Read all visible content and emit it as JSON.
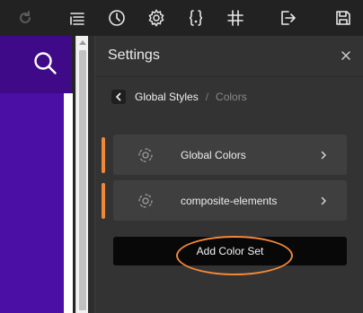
{
  "toolbar": {
    "icons": [
      "redo-icon",
      "history-list-icon",
      "clock-icon",
      "gear-icon",
      "code-braces-icon",
      "hash-icon",
      "exit-icon",
      "save-icon"
    ]
  },
  "preview": {
    "search_icon": "search-icon"
  },
  "panel": {
    "title": "Settings",
    "close_icon": "close-icon",
    "breadcrumb": {
      "back_icon": "chevron-left-icon",
      "active": "Global Styles",
      "separator": "/",
      "current": "Colors"
    },
    "color_sets": [
      {
        "label": "Global Colors",
        "indicator_color": "#f0883a"
      },
      {
        "label": "composite-elements",
        "indicator_color": "#f0883a"
      }
    ],
    "add_button_label": "Add Color Set"
  },
  "colors": {
    "accent_orange": "#f0883a",
    "purple_dark": "#3f0a87",
    "purple": "#4b0fa5",
    "panel_bg": "#333333",
    "row_bg": "#3f3f3f"
  }
}
